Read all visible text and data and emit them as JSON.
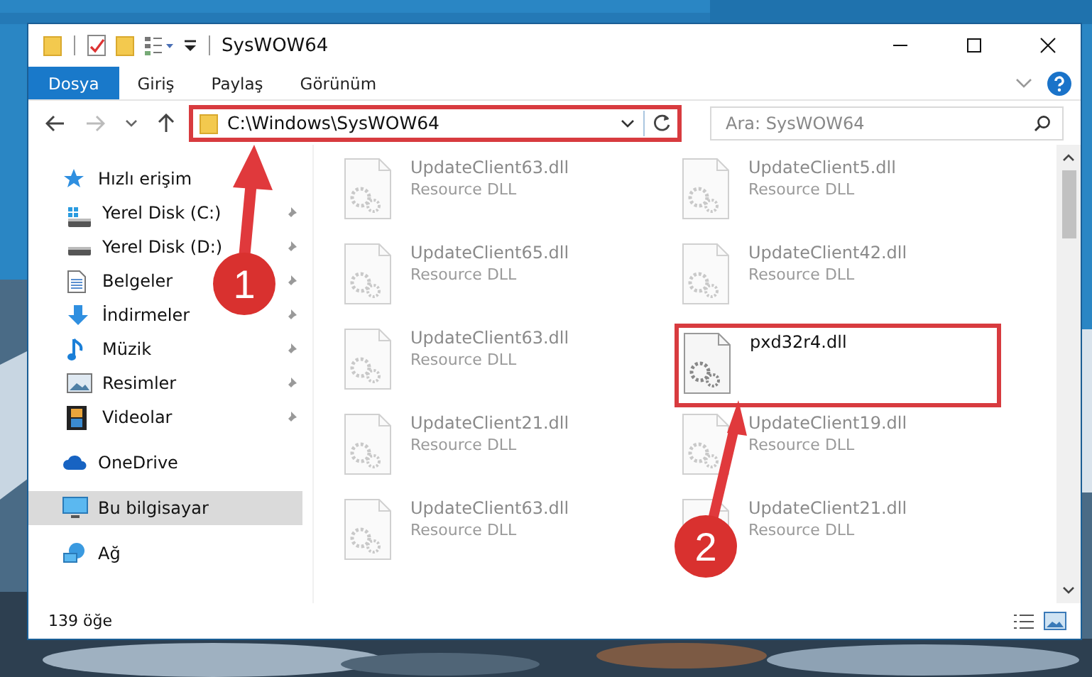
{
  "window": {
    "title": "SysWOW64"
  },
  "ribbon_tabs": [
    {
      "label": "Dosya",
      "selected": true
    },
    {
      "label": "Giriş",
      "selected": false
    },
    {
      "label": "Paylaş",
      "selected": false
    },
    {
      "label": "Görünüm",
      "selected": false
    }
  ],
  "address_bar": {
    "path": "C:\\Windows\\SysWOW64",
    "highlighted": true
  },
  "search": {
    "placeholder": "Ara: SysWOW64"
  },
  "sidebar": {
    "items": [
      {
        "label": "Hızlı erişim",
        "kind": "star",
        "selected": false,
        "children": [
          {
            "label": "Yerel Disk (C:)",
            "kind": "system-disk",
            "pinned": true,
            "selected": false
          },
          {
            "label": "Yerel Disk (D:)",
            "kind": "disk",
            "pinned": true,
            "selected": false
          },
          {
            "label": "Belgeler",
            "kind": "document",
            "pinned": true,
            "selected": false
          },
          {
            "label": "İndirmeler",
            "kind": "download",
            "pinned": true,
            "selected": false
          },
          {
            "label": "Müzik",
            "kind": "music",
            "pinned": true,
            "selected": false
          },
          {
            "label": "Resimler",
            "kind": "pictures",
            "pinned": true,
            "selected": false
          },
          {
            "label": "Videolar",
            "kind": "video",
            "pinned": true,
            "selected": false
          }
        ]
      },
      {
        "label": "OneDrive",
        "kind": "cloud",
        "selected": false
      },
      {
        "label": "Bu bilgisayar",
        "kind": "computer",
        "selected": true
      },
      {
        "label": "Ağ",
        "kind": "network",
        "selected": false
      }
    ]
  },
  "files": [
    {
      "name": "UpdateClient63.dll",
      "type": "Resource DLL",
      "blurred": true,
      "highlighted": false
    },
    {
      "name": "UpdateClient5.dll",
      "type": "Resource DLL",
      "blurred": true,
      "highlighted": false
    },
    {
      "name": "UpdateClient65.dll",
      "type": "Resource DLL",
      "blurred": true,
      "highlighted": false
    },
    {
      "name": "UpdateClient42.dll",
      "type": "Resource DLL",
      "blurred": true,
      "highlighted": false
    },
    {
      "name": "UpdateClient63.dll",
      "type": "Resource DLL",
      "blurred": true,
      "highlighted": false
    },
    {
      "name": "pxd32r4.dll",
      "blurred": false,
      "highlighted": true
    },
    {
      "name": "UpdateClient21.dll",
      "type": "Resource DLL",
      "blurred": true,
      "highlighted": false
    },
    {
      "name": "UpdateClient19.dll",
      "type": "Resource DLL",
      "blurred": true,
      "highlighted": false
    },
    {
      "name": "UpdateClient63.dll",
      "type": "Resource DLL",
      "blurred": true,
      "highlighted": false
    },
    {
      "name": "UpdateClient21.dll",
      "type": "Resource DLL",
      "blurred": true,
      "highlighted": false
    }
  ],
  "status_bar": {
    "item_count": "139 öğe"
  },
  "annotations": [
    {
      "number": "1"
    },
    {
      "number": "2"
    }
  ]
}
